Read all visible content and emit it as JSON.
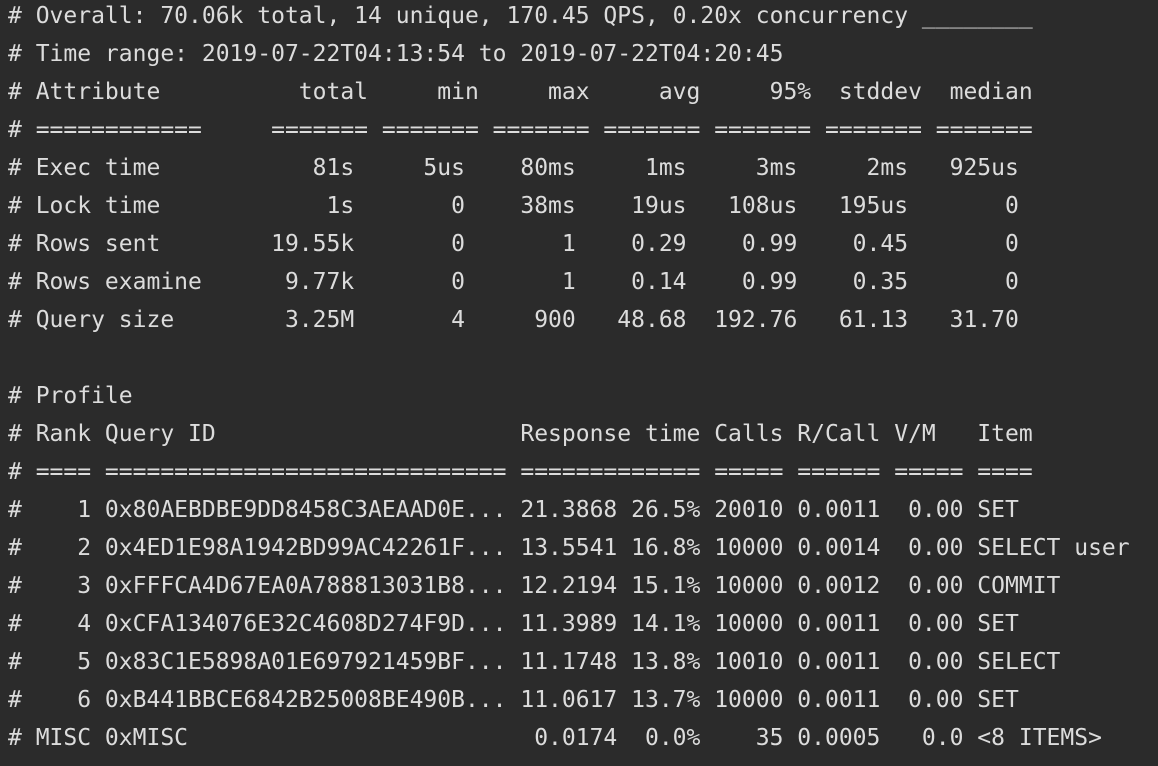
{
  "terminal": {
    "lines": [
      "# Overall: 70.06k total, 14 unique, 170.45 QPS, 0.20x concurrency ________",
      "# Time range: 2019-07-22T04:13:54 to 2019-07-22T04:20:45",
      "# Attribute          total     min     max     avg     95%  stddev  median",
      "# ============     ======= ======= ======= ======= ======= ======= =======",
      "# Exec time           81s     5us    80ms     1ms     3ms     2ms   925us",
      "# Lock time            1s       0    38ms    19us   108us   195us       0",
      "# Rows sent        19.55k       0       1    0.29    0.99    0.45       0",
      "# Rows examine      9.77k       0       1    0.14    0.99    0.35       0",
      "# Query size        3.25M       4     900   48.68  192.76   61.13   31.70",
      "",
      "# Profile",
      "# Rank Query ID                      Response time Calls R/Call V/M   Item",
      "# ==== ============================= ============= ===== ====== ===== ====",
      "#    1 0x80AEBDBE9DD8458C3AEAAD0E... 21.3868 26.5% 20010 0.0011  0.00 SET",
      "#    2 0x4ED1E98A1942BD99AC42261F... 13.5541 16.8% 10000 0.0014  0.00 SELECT user",
      "#    3 0xFFFCA4D67EA0A788813031B8... 12.2194 15.1% 10000 0.0012  0.00 COMMIT",
      "#    4 0xCFA134076E32C4608D274F9D... 11.3989 14.1% 10000 0.0011  0.00 SET",
      "#    5 0x83C1E5898A01E697921459BF... 11.1748 13.8% 10010 0.0011  0.00 SELECT",
      "#    6 0xB441BBCE6842B25008BE490B... 11.0617 13.7% 10000 0.0011  0.00 SET",
      "# MISC 0xMISC                         0.0174  0.0%    35 0.0005   0.0 <8 ITEMS>"
    ]
  }
}
